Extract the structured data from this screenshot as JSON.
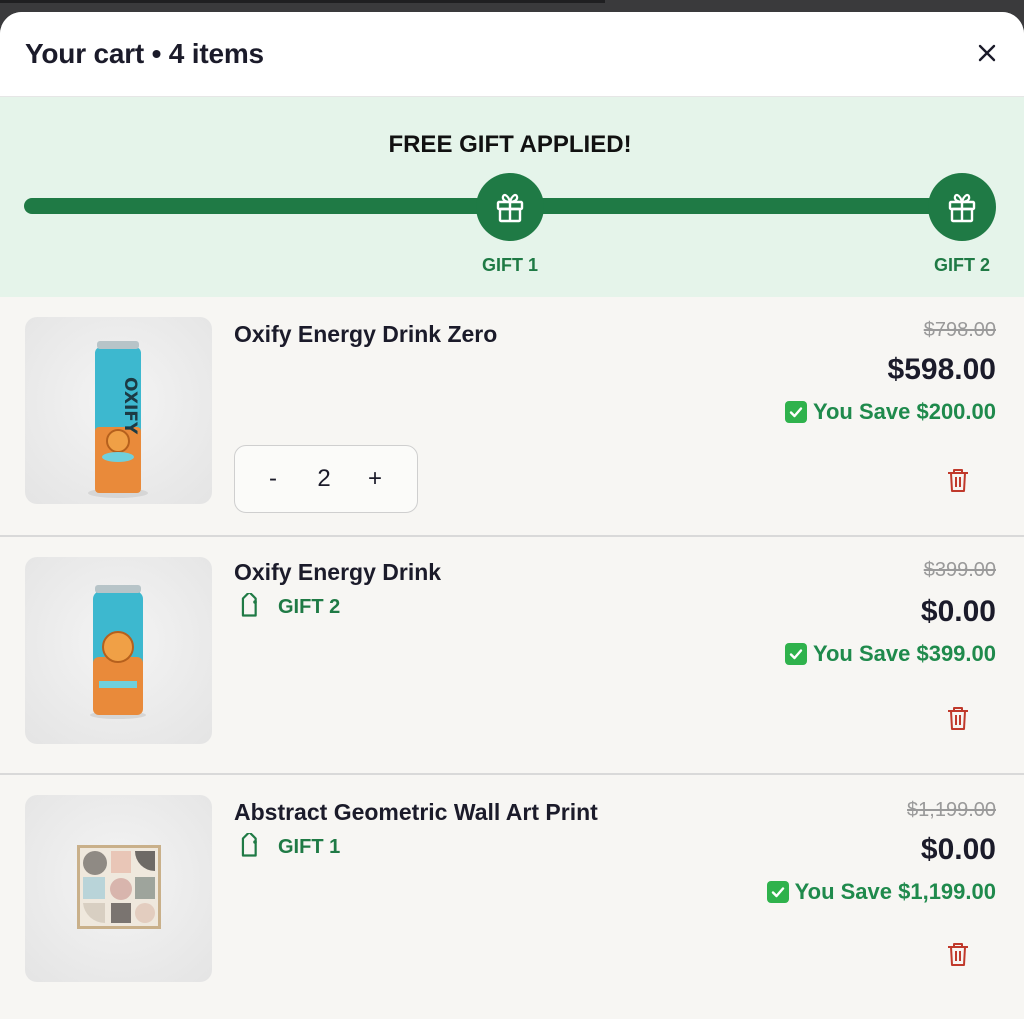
{
  "cart": {
    "title": "Your cart • 4 items",
    "close_icon": "close-icon"
  },
  "progress": {
    "message": "FREE GIFT APPLIED!",
    "milestones": [
      {
        "label": "GIFT 1",
        "icon": "gift-icon",
        "reached": true
      },
      {
        "label": "GIFT 2",
        "icon": "gift-icon",
        "reached": true
      }
    ],
    "fill_fraction": 1.0,
    "color": "#1f7a45"
  },
  "items": [
    {
      "name": "Oxify Energy Drink Zero",
      "compare_price": "$798.00",
      "price": "$598.00",
      "save_label": "You Save $200.00",
      "quantity": "2",
      "qty_minus": "-",
      "qty_plus": "+",
      "gift_tag": ""
    },
    {
      "name": "Oxify Energy Drink",
      "compare_price": "$399.00",
      "price": "$0.00",
      "save_label": "You Save $399.00",
      "gift_tag": "GIFT 2"
    },
    {
      "name": "Abstract Geometric Wall Art Print",
      "compare_price": "$1,199.00",
      "price": "$0.00",
      "save_label": "You Save $1,199.00",
      "gift_tag": "GIFT 1"
    }
  ],
  "colors": {
    "accent_green": "#1f7a45",
    "banner_bg": "#e5f4ea",
    "trash_red": "#c0392b"
  }
}
